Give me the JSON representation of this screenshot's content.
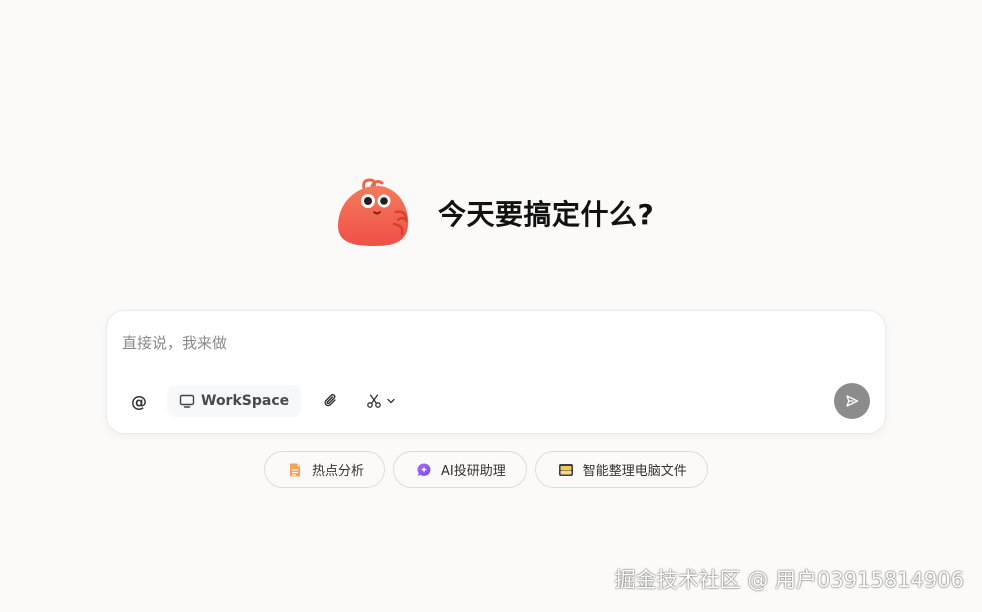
{
  "hero": {
    "title": "今天要搞定什么?"
  },
  "composer": {
    "placeholder": "直接说，我来做",
    "value": "",
    "toolbar": {
      "mention_label": "@",
      "workspace_label": "WorkSpace"
    },
    "icons": {
      "workspace": "monitor-icon",
      "attach": "paperclip-icon",
      "cut": "scissors-icon",
      "dropdown": "chevron-down-icon",
      "send": "send-icon"
    },
    "send_button_color": "#8c8c8c"
  },
  "suggestions": [
    {
      "label": "热点分析",
      "icon": "document-icon",
      "color": "#f5a05a"
    },
    {
      "label": "AI投研助理",
      "icon": "sparkle-chat-icon",
      "color": "#8a5cf6"
    },
    {
      "label": "智能整理电脑文件",
      "icon": "folder-icon",
      "color": "#f2c94c"
    }
  ],
  "watermark": {
    "text": "掘金技术社区 @ 用户03915814906"
  },
  "colors": {
    "background": "#fbfaf9",
    "mascot": "#f0624a"
  }
}
